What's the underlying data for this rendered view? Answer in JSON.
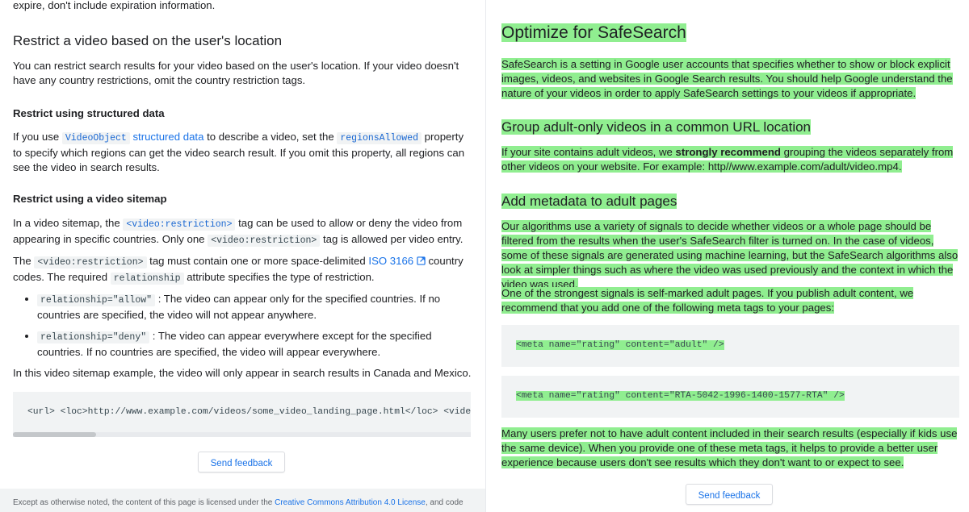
{
  "left": {
    "intro_tail": "expire, don't include expiration information.",
    "location": {
      "heading": "Restrict a video based on the user's location",
      "paragraph": "You can restrict search results for your video based on the user's location. If your video doesn't have any country restrictions, omit the country restriction tags."
    },
    "structured": {
      "heading": "Restrict using structured data",
      "p_before": "If you use ",
      "code_videoobject": "VideoObject",
      "link_structured_data": "structured data",
      "p_mid": " to describe a video, set the ",
      "code_regions": "regionsAllowed",
      "p_after": " property to specify which regions can get the video search result. If you omit this property, all regions can see the video in search results."
    },
    "sitemap": {
      "heading": "Restrict using a video sitemap",
      "p1_before": "In a video sitemap, the ",
      "p1_code1": "<video:restriction>",
      "p1_mid": " tag can be used to allow or deny the video from appearing in specific countries. Only one ",
      "p1_code2": "<video:restriction>",
      "p1_after": " tag is allowed per video entry.",
      "p2_before": "The ",
      "p2_code": "<video:restriction>",
      "p2_mid": " tag must contain one or more space-delimited ",
      "p2_link": "ISO 3166",
      "p2_mid2": " country codes. The required ",
      "p2_code2": "relationship",
      "p2_after": " attribute specifies the type of restriction.",
      "bullets": [
        {
          "code": "relationship=\"allow\"",
          "text": " : The video can appear only for the specified countries. If no countries are specified, the video will not appear anywhere."
        },
        {
          "code": "relationship=\"deny\"",
          "text": " : The video can appear everywhere except for the specified countries. If no countries are specified, the video will appear everywhere."
        }
      ],
      "example_text": "In this video sitemap example, the video will only appear in search results in Canada and Mexico.",
      "code_line": "<url> <loc>http://www.example.com/videos/some_video_landing_page.html</loc> <video:video>"
    },
    "feedback_label": "Send feedback",
    "footer": {
      "before": "Except as otherwise noted, the content of this page is licensed under the ",
      "link": "Creative Commons Attribution 4.0 License",
      "after": ", and code"
    }
  },
  "right": {
    "safesearch": {
      "heading": "Optimize for SafeSearch",
      "paragraph": "SafeSearch is a setting in Google user accounts that specifies whether to show or block explicit images, videos, and websites in Google Search results. You should help Google understand the nature of your videos in order to apply SafeSearch settings to your videos if appropriate."
    },
    "group": {
      "heading": "Group adult-only videos in a common URL location",
      "p_before": "If your site contains adult videos, we ",
      "p_bold": "strongly recommend",
      "p_after": " grouping the videos separately from other videos on your website. For example: http//www.example.com/adult/video.mp4."
    },
    "metadata": {
      "heading": "Add metadata to adult pages",
      "p1": "Our algorithms use a variety of signals to decide whether videos or a whole page should be filtered from the results when the user's SafeSearch filter is turned on. In the case of videos, some of these signals are generated using machine learning, but the SafeSearch algorithms also look at simpler things such as where the video was used previously and the context in which the video was used.",
      "p2": "One of the strongest signals is self-marked adult pages. If you publish adult content, we recommend that you add one of the following meta tags to your pages:",
      "code1": "<meta name=\"rating\" content=\"adult\" />",
      "code2": "<meta name=\"rating\" content=\"RTA-5042-1996-1400-1577-RTA\" />",
      "p3": "Many users prefer not to have adult content included in their search results (especially if kids use the same device). When you provide one of these meta tags, it helps to provide a better user experience because users don't see results which they don't want to or expect to see."
    },
    "feedback_label": "Send feedback"
  },
  "colors": {
    "highlight": "#90ee90",
    "link": "#1a73e8",
    "code_bg": "#f1f3f4"
  },
  "icons": {
    "external_link": "external-link-icon"
  }
}
